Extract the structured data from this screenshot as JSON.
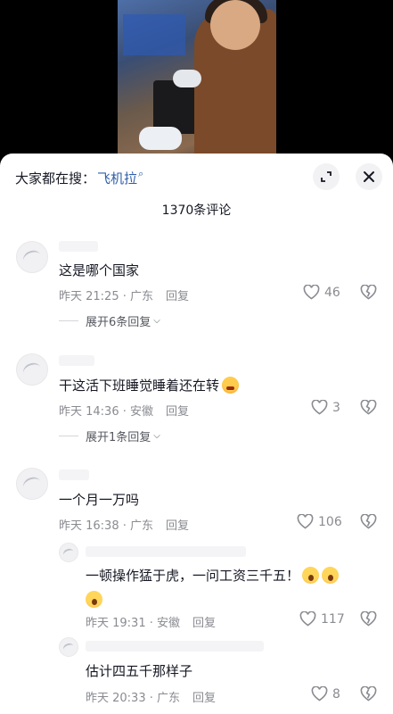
{
  "search": {
    "prefix": "大家都在搜：",
    "term": "飞机拉"
  },
  "comment_count": "1370条评论",
  "comments": [
    {
      "text": "这是哪个国家",
      "time": "昨天 21:25 · 广东",
      "reply": "回复",
      "likes": "46",
      "expand": "展开6条回复"
    },
    {
      "text": "干这活下班睡觉睡着还在转",
      "time": "昨天 14:36 · 安徽",
      "reply": "回复",
      "likes": "3",
      "expand": "展开1条回复"
    },
    {
      "text": "一个月一万吗",
      "time": "昨天 16:38 · 广东",
      "reply": "回复",
      "likes": "106"
    }
  ],
  "replies": [
    {
      "text": "一顿操作猛于虎，一问工资三千五！",
      "time": "昨天 19:31 · 安徽",
      "reply": "回复",
      "likes": "117"
    },
    {
      "text": "估计四五千那样子",
      "time": "昨天 20:33 · 广东",
      "reply": "回复",
      "likes": "8"
    }
  ],
  "icons": {
    "expand": "expand-icon",
    "close": "close-icon",
    "like": "heart-icon",
    "dislike": "broken-heart-icon",
    "search": "search-icon"
  },
  "colors": {
    "link": "#2f5ea8",
    "text": "#161823",
    "meta": "#8a8b91"
  }
}
